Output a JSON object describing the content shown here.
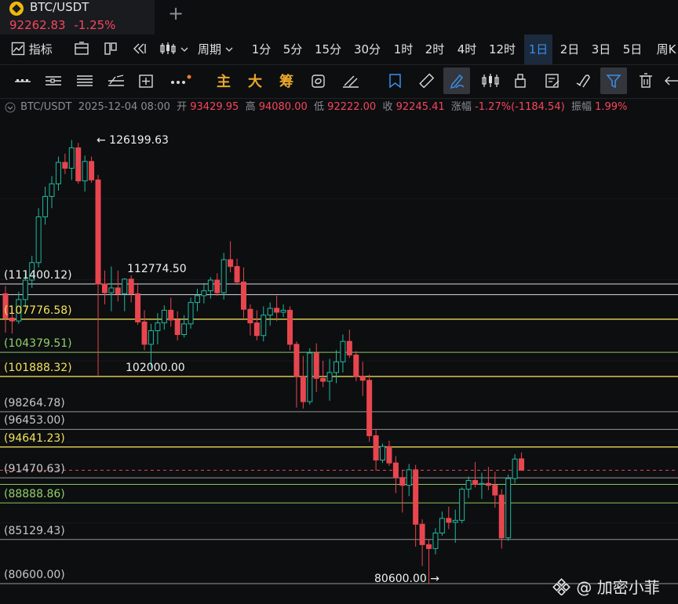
{
  "tab": {
    "symbol": "BTC/USDT",
    "price": "92262.83",
    "change": "-1.25%",
    "add_icon": "+"
  },
  "toolbar": {
    "indicator_label": "指标",
    "period_label": "周期",
    "periods": [
      "1分",
      "5分",
      "15分",
      "30分",
      "1时",
      "2时",
      "4时",
      "12时",
      "1日",
      "2日",
      "3日",
      "5日",
      "周K"
    ],
    "active_period": "1日"
  },
  "drawbar": {
    "text_buttons": [
      "主",
      "大",
      "筹"
    ]
  },
  "info": {
    "symbol": "BTC/USDT",
    "datetime": "2025-12-04 08:00",
    "open_label": "开",
    "open": "93429.95",
    "high_label": "高",
    "high": "94080.00",
    "low_label": "低",
    "low": "92222.00",
    "close_label": "收",
    "close": "92245.41",
    "change_label": "涨幅",
    "change": "-1.27%(-1184.54)",
    "amp_label": "振幅",
    "amp": "1.99%"
  },
  "colors": {
    "up": "#1fb9a0",
    "down": "#e8464f",
    "accent": "#3a8fe8",
    "yellow": "#f3e35a",
    "green": "#8fd16a"
  },
  "chart_data": {
    "type": "candlestick",
    "y_range": [
      78500,
      128500
    ],
    "levels": [
      {
        "label": "(111400.12)",
        "value": 111400.12,
        "color": "white"
      },
      {
        "label": "",
        "value": 110300,
        "color": "white"
      },
      {
        "label": "(107776.58)",
        "value": 107776.58,
        "color": "yellow"
      },
      {
        "label": "(104379.51)",
        "value": 104379.51,
        "color": "green"
      },
      {
        "label": "(101888.32)",
        "value": 101888.32,
        "color": "yellow"
      },
      {
        "label": "(98264.78)",
        "value": 98264.78,
        "color": "grey"
      },
      {
        "label": "(96453.00)",
        "value": 96453.0,
        "color": "grey"
      },
      {
        "label": "(94641.23)",
        "value": 94641.23,
        "color": "yellow"
      },
      {
        "label": "(91470.63)",
        "value": 91470.63,
        "color": "grey"
      },
      {
        "label": "",
        "value": 90800,
        "color": "green"
      },
      {
        "label": "(88888.86)",
        "value": 88888.86,
        "color": "green"
      },
      {
        "label": "(85129.43)",
        "value": 85129.43,
        "color": "grey"
      },
      {
        "label": "(80600.00)",
        "value": 80600.0,
        "color": "grey"
      }
    ],
    "current_price": 92245.41,
    "annotations": [
      {
        "text": "← 126199.63",
        "value": 126199.63
      },
      {
        "text": "112774.50",
        "value": 112774.5
      },
      {
        "text": "102000.00",
        "value": 102000.0
      },
      {
        "text": "80600.00 →",
        "value": 80600.0
      }
    ],
    "candles": [
      [
        110400,
        111200,
        106400,
        107900
      ],
      [
        107900,
        108800,
        106300,
        107600
      ],
      [
        107600,
        110600,
        107300,
        109800
      ],
      [
        109800,
        112600,
        109000,
        111800
      ],
      [
        111800,
        114300,
        111000,
        113600
      ],
      [
        113600,
        119200,
        113100,
        118300
      ],
      [
        118300,
        121400,
        117500,
        120400
      ],
      [
        120400,
        122500,
        119200,
        121700
      ],
      [
        121700,
        124500,
        121000,
        123900
      ],
      [
        123900,
        124800,
        122700,
        123300
      ],
      [
        123300,
        126199.63,
        122100,
        125400
      ],
      [
        125400,
        125900,
        121700,
        122000
      ],
      [
        122000,
        124600,
        120900,
        124000
      ],
      [
        124000,
        124500,
        121800,
        122100
      ],
      [
        122100,
        122600,
        102000,
        111400
      ],
      [
        111400,
        112774.5,
        109300,
        110500
      ],
      [
        110500,
        113200,
        108600,
        111000
      ],
      [
        111000,
        112774.5,
        109600,
        110400
      ],
      [
        110400,
        112000,
        108600,
        111900
      ],
      [
        111900,
        112300,
        109500,
        110400
      ],
      [
        110400,
        111500,
        107200,
        107500
      ],
      [
        107500,
        108700,
        104600,
        105200
      ],
      [
        105200,
        107300,
        102800,
        106600
      ],
      [
        106600,
        108400,
        105200,
        107400
      ],
      [
        107400,
        109200,
        106700,
        108700
      ],
      [
        108700,
        110000,
        107000,
        107700
      ],
      [
        107700,
        108600,
        105600,
        106200
      ],
      [
        106200,
        108200,
        105900,
        107300
      ],
      [
        107300,
        110000,
        106800,
        109500
      ],
      [
        109500,
        110900,
        108600,
        110200
      ],
      [
        110200,
        111500,
        109400,
        110700
      ],
      [
        110700,
        112100,
        109900,
        111800
      ],
      [
        111800,
        112500,
        110200,
        110500
      ],
      [
        110500,
        114600,
        109800,
        113900
      ],
      [
        113900,
        115800,
        112600,
        113200
      ],
      [
        113200,
        114000,
        111300,
        111600
      ],
      [
        111600,
        113100,
        107900,
        108800
      ],
      [
        108800,
        109300,
        106100,
        107400
      ],
      [
        107400,
        108700,
        105600,
        106100
      ],
      [
        106100,
        109100,
        105500,
        108200
      ],
      [
        108200,
        109500,
        107100,
        108900
      ],
      [
        108900,
        110200,
        107600,
        108500
      ],
      [
        108500,
        109300,
        108000,
        108700
      ],
      [
        108700,
        109100,
        104600,
        105200
      ],
      [
        105200,
        105500,
        98700,
        101900
      ],
      [
        101900,
        104000,
        98600,
        99300
      ],
      [
        99300,
        104800,
        99000,
        104300
      ],
      [
        104300,
        105300,
        100300,
        101700
      ],
      [
        101700,
        103500,
        100800,
        101400
      ],
      [
        101400,
        103700,
        99400,
        102300
      ],
      [
        102300,
        104600,
        101200,
        103400
      ],
      [
        103400,
        106200,
        102300,
        105500
      ],
      [
        105500,
        106700,
        103800,
        104100
      ],
      [
        104100,
        104500,
        101400,
        101900
      ],
      [
        101900,
        103400,
        99900,
        101500
      ],
      [
        101500,
        102100,
        95200,
        95800
      ],
      [
        95800,
        96500,
        92200,
        93300
      ],
      [
        93300,
        95000,
        93000,
        94700
      ],
      [
        94700,
        95300,
        92700,
        93000
      ],
      [
        93000,
        93700,
        89900,
        91500
      ],
      [
        91500,
        92300,
        87900,
        90700
      ],
      [
        90700,
        92900,
        89600,
        92300
      ],
      [
        92300,
        92800,
        84400,
        86700
      ],
      [
        86700,
        87200,
        82400,
        84600
      ],
      [
        84600,
        85100,
        80600,
        84200
      ],
      [
        84200,
        86300,
        83600,
        85800
      ],
      [
        85800,
        88000,
        85500,
        87300
      ],
      [
        87300,
        88500,
        86200,
        86900
      ],
      [
        86900,
        88200,
        84800,
        87100
      ],
      [
        87100,
        90500,
        86800,
        90300
      ],
      [
        90300,
        91600,
        89400,
        91200
      ],
      [
        91200,
        93100,
        90500,
        90800
      ],
      [
        90800,
        92000,
        89300,
        90900
      ],
      [
        90900,
        92600,
        90200,
        90700
      ],
      [
        90700,
        92100,
        88400,
        89700
      ],
      [
        89700,
        90300,
        84200,
        85300
      ],
      [
        85300,
        91800,
        85000,
        91400
      ],
      [
        91400,
        93900,
        90900,
        93400
      ],
      [
        93429.95,
        94080,
        92222,
        92245.41
      ]
    ]
  }
}
